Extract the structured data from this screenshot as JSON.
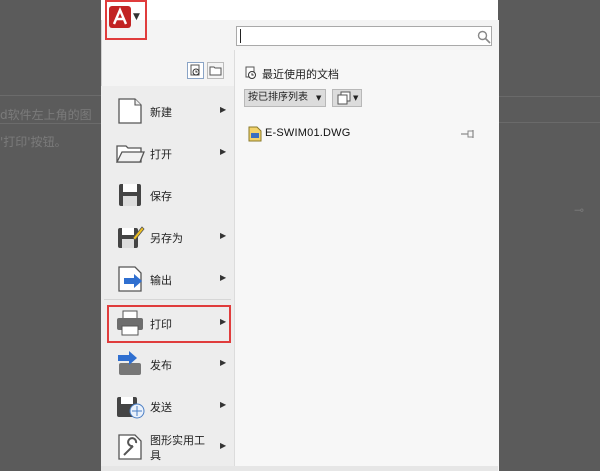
{
  "background_doc": {
    "line1": "d软件左上角的图",
    "line2": "'打印'按钮。"
  },
  "search": {
    "placeholder": ""
  },
  "recent": {
    "title": "最近使用的文档",
    "sort_label": "按已排序列表",
    "files": [
      {
        "name": "E-SWIM01.DWG"
      }
    ]
  },
  "menu": {
    "items": [
      {
        "label": "新建",
        "icon": "new-file-icon",
        "has_arrow": true
      },
      {
        "label": "打开",
        "icon": "open-folder-icon",
        "has_arrow": true
      },
      {
        "label": "保存",
        "icon": "save-icon",
        "has_arrow": false
      },
      {
        "label": "另存为",
        "icon": "save-as-icon",
        "has_arrow": true
      },
      {
        "label": "输出",
        "icon": "export-icon",
        "has_arrow": true
      },
      {
        "label": "打印",
        "icon": "print-icon",
        "has_arrow": true
      },
      {
        "label": "发布",
        "icon": "publish-icon",
        "has_arrow": true
      },
      {
        "label": "发送",
        "icon": "send-icon",
        "has_arrow": true
      },
      {
        "label": "图形实用工具",
        "icon": "drawing-utilities-icon",
        "has_arrow": true
      }
    ]
  },
  "colors": {
    "highlight": "#e03c3c",
    "app_logo": "#d62b2b"
  }
}
